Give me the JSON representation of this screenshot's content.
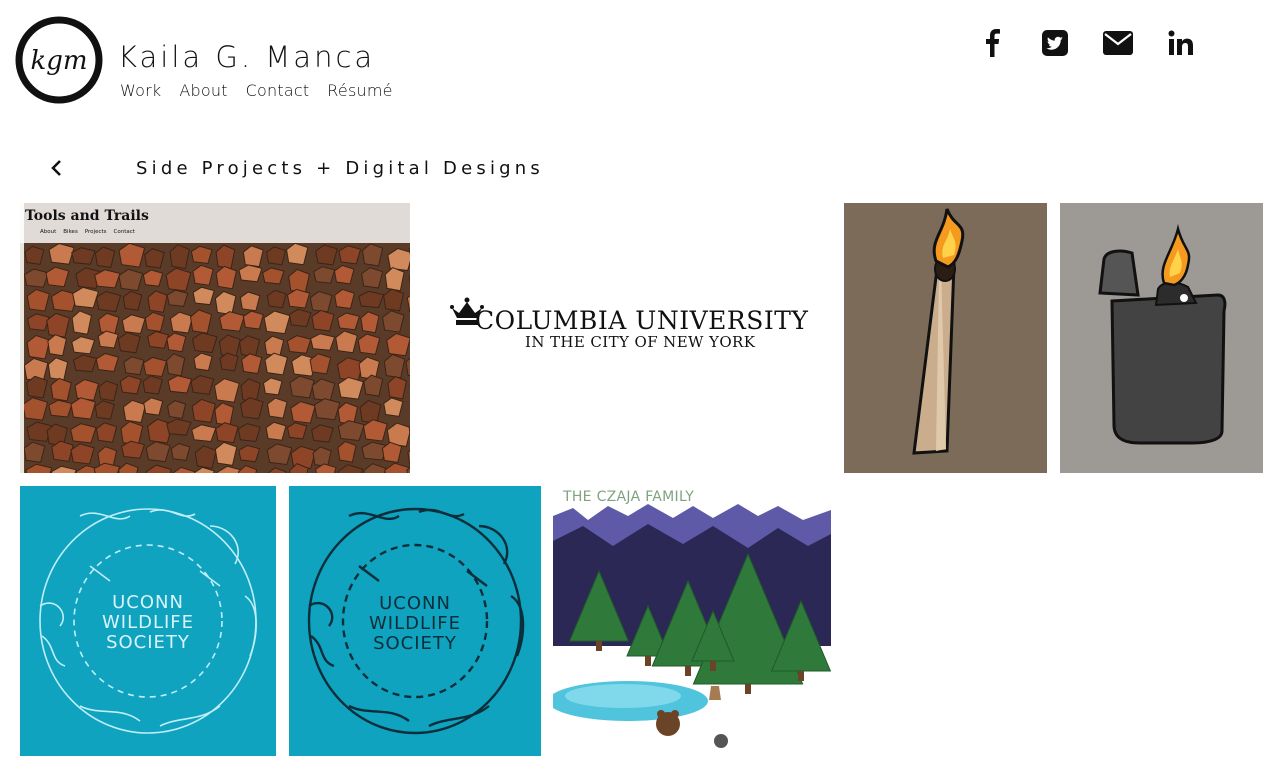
{
  "header": {
    "logo_text": "kgm",
    "brand_name": "Kaila G. Manca",
    "nav": [
      "Work",
      "About",
      "Contact",
      "Résumé"
    ],
    "social_icons": [
      "facebook-icon",
      "twitter-icon",
      "email-icon",
      "linkedin-icon"
    ]
  },
  "section": {
    "title": "Side Projects + Digital Designs",
    "back_icon": "chevron-left-icon"
  },
  "tiles": [
    {
      "name": "tools-and-trails",
      "title": "Tools and Trails",
      "nav": [
        "About",
        "Bikes",
        "Projects",
        "Contact"
      ]
    },
    {
      "name": "columbia-university",
      "line1": "Columbia University",
      "line2": "IN THE CITY OF NEW YORK"
    },
    {
      "name": "match-illustration"
    },
    {
      "name": "lighter-illustration"
    },
    {
      "name": "uconn-wildlife-light",
      "text": [
        "UCONN",
        "WILDLIFE",
        "SOCIETY"
      ]
    },
    {
      "name": "uconn-wildlife-dark",
      "text": [
        "UCONN",
        "WILDLIFE",
        "SOCIETY"
      ]
    },
    {
      "name": "czaja-family",
      "title": "THE CZAJA FAMILY"
    }
  ],
  "colors": {
    "teal": "#0fa3c0",
    "match_bg": "#7c6b59",
    "lighter_bg": "#9d9995",
    "mountain_dark": "#2b2856",
    "mountain_light": "#5f5aa8"
  }
}
